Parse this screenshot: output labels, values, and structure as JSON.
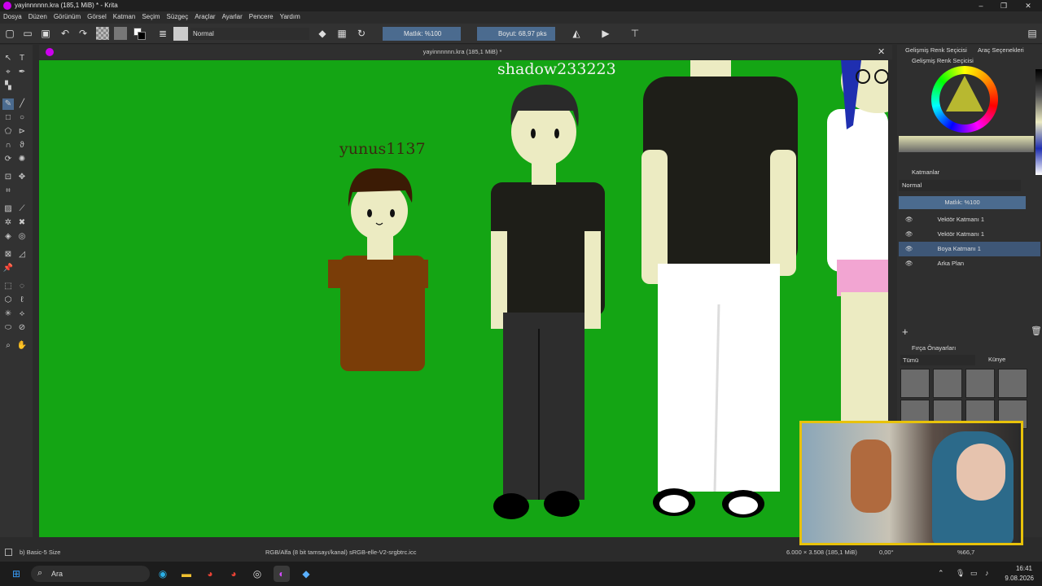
{
  "window": {
    "title": "yayinnnnnn.kra (185,1 MiB) * - Krita"
  },
  "menu": [
    "Dosya",
    "Düzen",
    "Görünüm",
    "Görsel",
    "Katman",
    "Seçim",
    "Süzgeç",
    "Araçlar",
    "Ayarlar",
    "Pencere",
    "Yardım"
  ],
  "toolbar": {
    "blend_mode": "Normal",
    "opacity": "Matlık: %100",
    "size": "Boyut: 68,97 pks"
  },
  "document": {
    "tab_title": "yayinnnnnn.kra (185,1 MiB) *"
  },
  "canvas": {
    "label_left": "yunus1137",
    "label_mid": "shadow233223"
  },
  "dock": {
    "tabs": [
      "Gelişmiş Renk Seçicisi",
      "Araç Seçenekleri"
    ],
    "color_panel_title": "Gelişmiş Renk Seçicisi",
    "layers_title": "Katmanlar",
    "layers_blend": "Normal",
    "layers_opacity": "Matlık: %100",
    "layers": [
      {
        "name": "Vektör Katmanı 1"
      },
      {
        "name": "Vektör Katmanı 1"
      },
      {
        "name": "Boya Katmanı 1"
      },
      {
        "name": "Arka Plan"
      }
    ],
    "brush_title": "Fırça Önayarları",
    "brush_filter": "Tümü",
    "brush_tag": "Künye"
  },
  "status": {
    "brush": "b) Basic-5 Size",
    "color_space": "RGB/Alfa (8 bit tamsayı/kanal) sRGB-elle-V2-srgbtrc.icc",
    "dimensions": "6.000 × 3.508 (185,1 MiB)",
    "rotation": "0,00°",
    "zoom": "%66,7"
  },
  "taskbar": {
    "search": "Ara",
    "time": "16:41",
    "date": "9.08.2026"
  },
  "colors": {
    "canvas": "#14a514",
    "accent": "#4b6b8f",
    "webcam_border": "#e8c20a"
  }
}
